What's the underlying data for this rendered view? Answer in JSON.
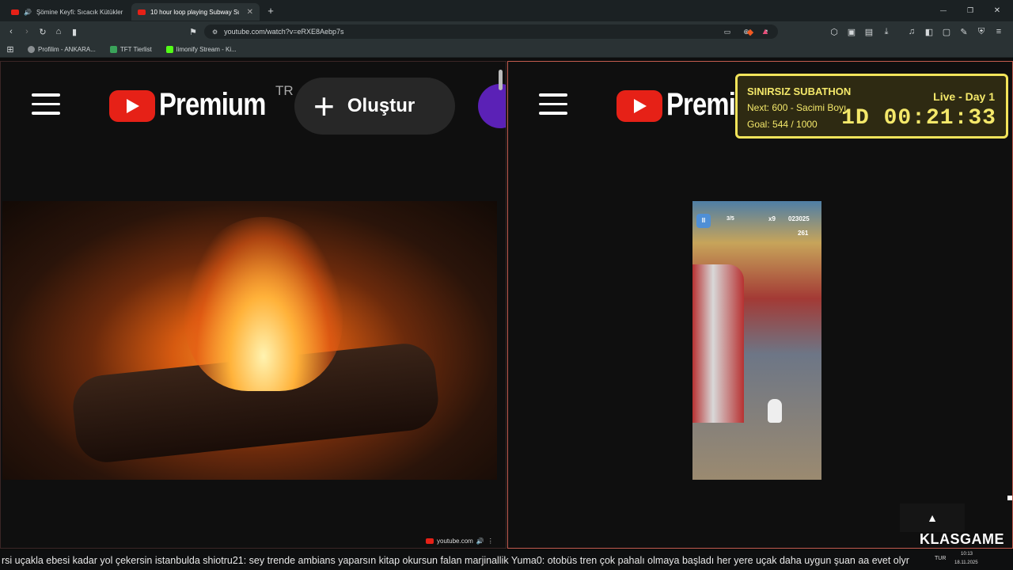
{
  "tabs": [
    {
      "title": "Şömine Keyfi: Sıcacık Kütükler"
    },
    {
      "title": "10 hour loop playing Subway Su"
    }
  ],
  "new_tab": "+",
  "window_controls": {
    "minimize": "—",
    "restore": "❐",
    "close": "✕"
  },
  "url": "youtube.com/watch?v=eRXE8Aebp7s",
  "bookmarks": [
    "Profilim - ANKARA...",
    "TFT Tierlist",
    "limonify Stream - Ki..."
  ],
  "left_player": {
    "brand": "Premium",
    "country": "TR",
    "create_label": "Oluştur",
    "source_badge": "youtube.com"
  },
  "right_player": {
    "brand": "Premiu"
  },
  "overlay": {
    "title": "SINIRSIZ SUBATHON",
    "next": "Next: 600 - Sacimi Boyı",
    "goal": "Goal: 544 / 1000",
    "live": "Live - Day 1",
    "timer": "1D 00:21:33"
  },
  "game_hud": {
    "pause": "II",
    "lives": "3/5",
    "multiplier": "x9",
    "score": "023025",
    "coins": "261"
  },
  "watermark": "KLASGAME",
  "chat": {
    "text": "rsi uçakla ebesi kadar yol çekersin istanbulda   shiotru21: sey trende ambians yaparsın kitap okursun falan marjinallik   Yuma0: otobüs tren çok pahalı olmaya başladı her yere uçak daha uygun şuan   aa evet olyr"
  },
  "taskbar": {
    "lang": "TUR",
    "time": "10:13",
    "date": "18.11.2025"
  },
  "colors": {
    "accent": "#e62117",
    "overlay_border": "#f2e45a",
    "overlay_text": "#f4e86a",
    "klas": "#ff4d2e"
  }
}
